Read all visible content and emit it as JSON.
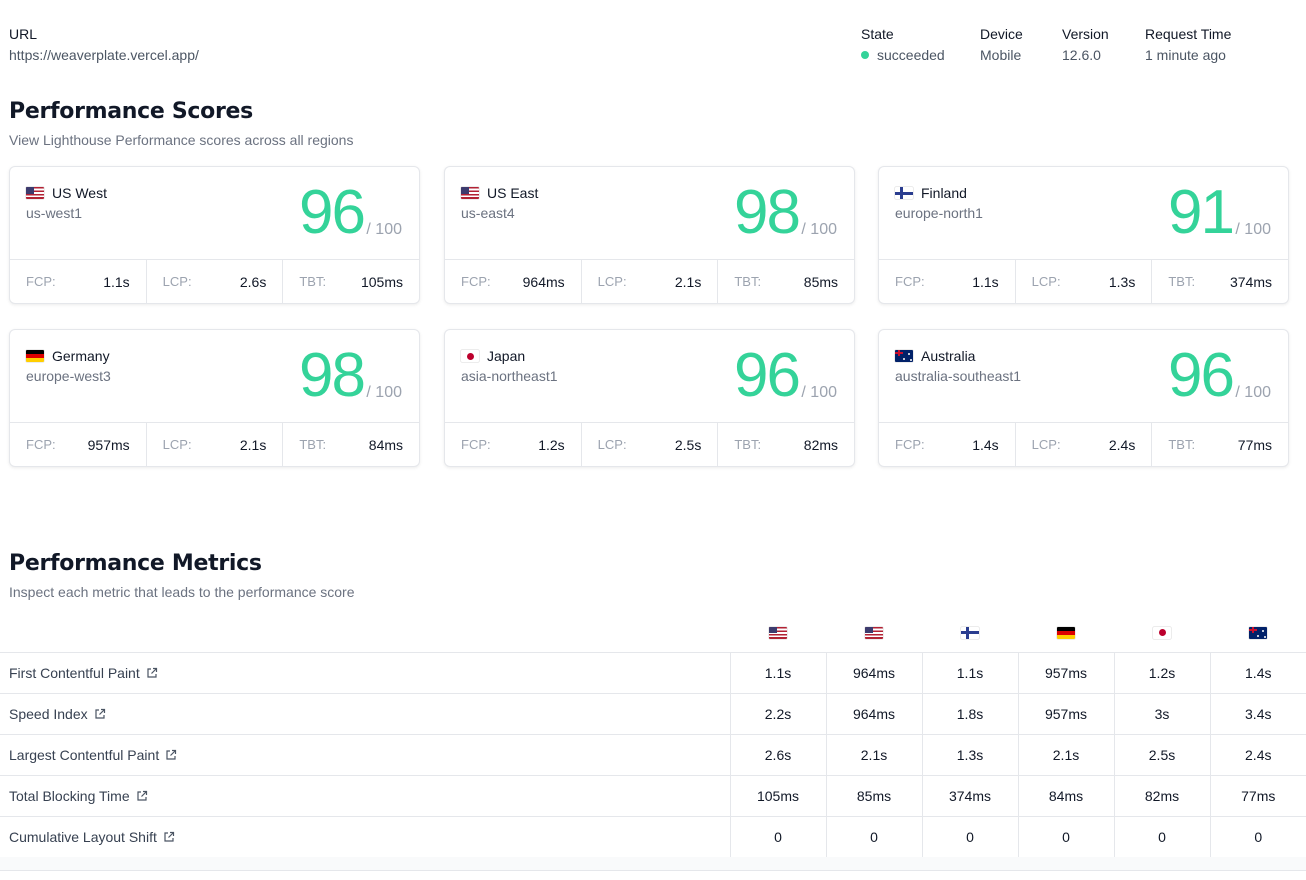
{
  "header": {
    "url_label": "URL",
    "url_value": "https://weaverplate.vercel.app/",
    "state_label": "State",
    "state_value": "succeeded",
    "device_label": "Device",
    "device_value": "Mobile",
    "version_label": "Version",
    "version_value": "12.6.0",
    "request_label": "Request Time",
    "request_value": "1 minute ago"
  },
  "scores": {
    "title": "Performance Scores",
    "subtitle": "View Lighthouse Performance scores across all regions",
    "out_of": "/ 100",
    "fcp_label": "FCP:",
    "lcp_label": "LCP:",
    "tbt_label": "TBT:",
    "cards": [
      {
        "name": "US West",
        "region": "us-west1",
        "score": "96",
        "fcp": "1.1s",
        "lcp": "2.6s",
        "tbt": "105ms",
        "flag": "us-flag-icon"
      },
      {
        "name": "US East",
        "region": "us-east4",
        "score": "98",
        "fcp": "964ms",
        "lcp": "2.1s",
        "tbt": "85ms",
        "flag": "us-flag-icon"
      },
      {
        "name": "Finland",
        "region": "europe-north1",
        "score": "91",
        "fcp": "1.1s",
        "lcp": "1.3s",
        "tbt": "374ms",
        "flag": "finland-flag-icon"
      },
      {
        "name": "Germany",
        "region": "europe-west3",
        "score": "98",
        "fcp": "957ms",
        "lcp": "2.1s",
        "tbt": "84ms",
        "flag": "germany-flag-icon"
      },
      {
        "name": "Japan",
        "region": "asia-northeast1",
        "score": "96",
        "fcp": "1.2s",
        "lcp": "2.5s",
        "tbt": "82ms",
        "flag": "japan-flag-icon"
      },
      {
        "name": "Australia",
        "region": "australia-southeast1",
        "score": "96",
        "fcp": "1.4s",
        "lcp": "2.4s",
        "tbt": "77ms",
        "flag": "australia-flag-icon"
      }
    ]
  },
  "metrics": {
    "title": "Performance Metrics",
    "subtitle": "Inspect each metric that leads to the performance score",
    "column_flags": [
      "us-flag-icon",
      "us-flag-icon",
      "finland-flag-icon",
      "germany-flag-icon",
      "japan-flag-icon",
      "australia-flag-icon"
    ],
    "rows": [
      {
        "name": "First Contentful Paint",
        "values": [
          "1.1s",
          "964ms",
          "1.1s",
          "957ms",
          "1.2s",
          "1.4s"
        ]
      },
      {
        "name": "Speed Index",
        "values": [
          "2.2s",
          "964ms",
          "1.8s",
          "957ms",
          "3s",
          "3.4s"
        ]
      },
      {
        "name": "Largest Contentful Paint",
        "values": [
          "2.6s",
          "2.1s",
          "1.3s",
          "2.1s",
          "2.5s",
          "2.4s"
        ]
      },
      {
        "name": "Total Blocking Time",
        "values": [
          "105ms",
          "85ms",
          "374ms",
          "84ms",
          "82ms",
          "77ms"
        ]
      },
      {
        "name": "Cumulative Layout Shift",
        "values": [
          "0",
          "0",
          "0",
          "0",
          "0",
          "0"
        ]
      }
    ]
  },
  "colors": {
    "score_green": "#34d399",
    "state_dot": "#34d399"
  }
}
